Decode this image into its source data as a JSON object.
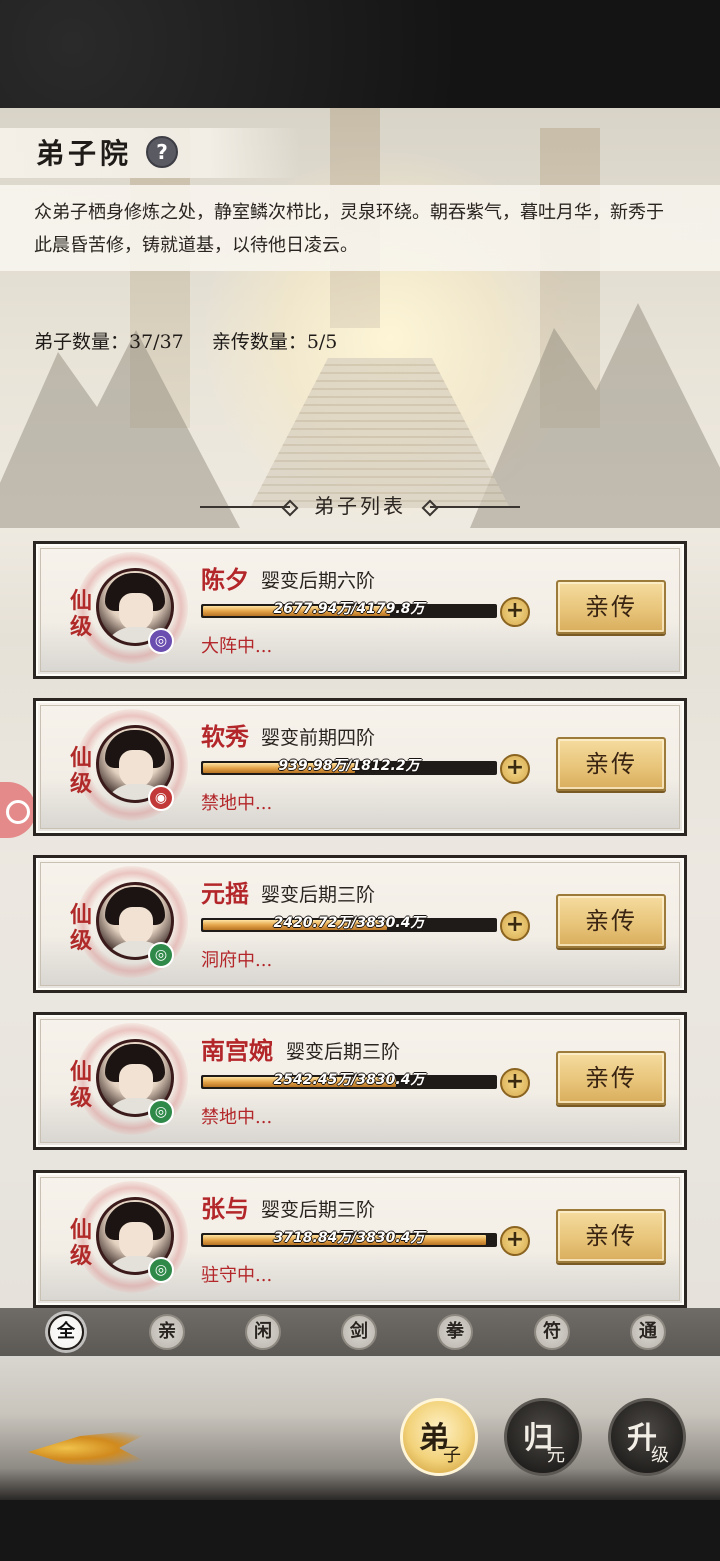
{
  "header": {
    "title": "弟子院",
    "help_icon": "?"
  },
  "description": "众弟子栖身修炼之处，静室鳞次栉比，灵泉环绕。朝吞紫气，暮吐月华，新秀于此晨昏苦修，铸就道基，以待他日凌云。",
  "stats": {
    "disciple_count": "弟子数量：37/37",
    "personal_count": "亲传数量：5/5"
  },
  "list_title": "弟子列表",
  "disciples": [
    {
      "rank": "仙级",
      "name": "陈夕",
      "realm": "婴变后期六阶",
      "exp_text": "2677.94万/4179.8万",
      "exp_progress": 0.64,
      "status": "大阵中...",
      "element_icon": "vortex-icon",
      "element_color": "#6a4fb0",
      "action_label": "亲传"
    },
    {
      "rank": "仙级",
      "name": "软秀",
      "realm": "婴变前期四阶",
      "exp_text": "939.98万/1812.2万",
      "exp_progress": 0.52,
      "status": "禁地中...",
      "element_icon": "flame-icon",
      "element_color": "#c23838",
      "action_label": "亲传"
    },
    {
      "rank": "仙级",
      "name": "元摇",
      "realm": "婴变后期三阶",
      "exp_text": "2420.72万/3830.4万",
      "exp_progress": 0.63,
      "status": "洞府中...",
      "element_icon": "wind-icon",
      "element_color": "#2f8a4a",
      "action_label": "亲传"
    },
    {
      "rank": "仙级",
      "name": "南宫婉",
      "realm": "婴变后期三阶",
      "exp_text": "2542.45万/3830.4万",
      "exp_progress": 0.66,
      "status": "禁地中...",
      "element_icon": "wind-icon",
      "element_color": "#2f8a4a",
      "action_label": "亲传"
    },
    {
      "rank": "仙级",
      "name": "张与",
      "realm": "婴变后期三阶",
      "exp_text": "3718.84万/3830.4万",
      "exp_progress": 0.97,
      "status": "驻守中...",
      "element_icon": "wind-icon",
      "element_color": "#2f8a4a",
      "action_label": "亲传"
    }
  ],
  "filters": [
    "全",
    "亲",
    "闲",
    "剑",
    "拳",
    "符",
    "通"
  ],
  "active_filter": "全",
  "bottom_nav": [
    {
      "big": "弟",
      "small": "子",
      "active": true
    },
    {
      "big": "归",
      "small": "元",
      "active": false
    },
    {
      "big": "升",
      "small": "级",
      "active": false
    }
  ]
}
